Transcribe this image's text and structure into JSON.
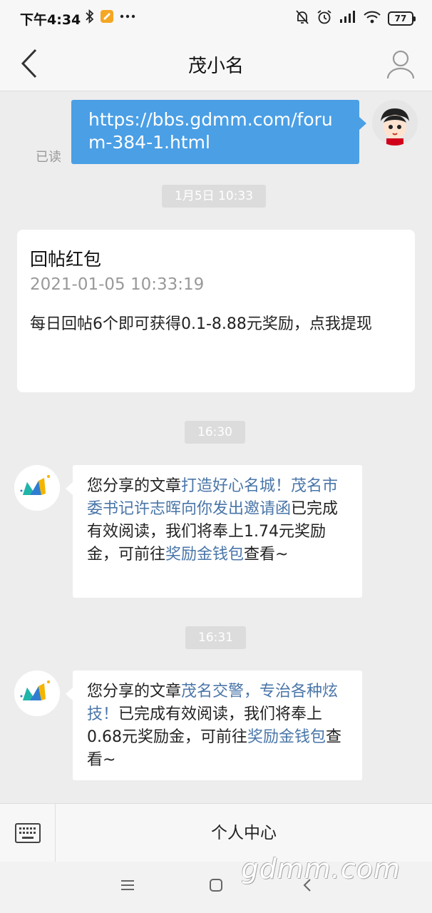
{
  "status_bar": {
    "time": "下午4:34",
    "battery": "77",
    "icons_left": [
      "bluetooth-icon",
      "notes-icon",
      "more-icon"
    ],
    "icons_right": [
      "mute-icon",
      "alarm-icon",
      "signal-icon",
      "wifi-icon",
      "battery-icon"
    ]
  },
  "nav": {
    "title": "茂小名",
    "back_icon": "chevron-left-icon",
    "profile_icon": "person-icon"
  },
  "messages": {
    "outgoing": {
      "text": "https://bbs.gdmm.com/forum-384-1.html",
      "status": "已读"
    },
    "time_1": "1月5日 10:33",
    "card": {
      "title": "回帖红包",
      "date": "2021-01-05 10:33:19",
      "body": "每日回帖6个即可获得0.1-8.88元奖励，点我提现"
    },
    "time_2": "16:30",
    "msg_1": {
      "prefix": "您分享的文章",
      "link": "打造好心名城！茂名市委书记许志晖向你发出邀请函",
      "middle": "已完成有效阅读，我们将奉上1.74元奖励金，可前往",
      "wallet": "奖励金钱包",
      "suffix": "查看~"
    },
    "time_3": "16:31",
    "msg_2": {
      "prefix": "您分享的文章",
      "link": "茂名交警，专治各种炫技！",
      "middle": "已完成有效阅读，我们将奉上0.68元奖励金，可前往",
      "wallet": "奖励金钱包",
      "suffix": "查看~"
    }
  },
  "bottom_bar": {
    "keyboard_icon": "keyboard-icon",
    "menu_label": "个人中心"
  },
  "system_nav": {
    "icons": [
      "menu-icon",
      "home-icon",
      "back-icon"
    ],
    "watermark": "gdmm.com"
  },
  "colors": {
    "bubble_out": "#4a9fe5",
    "link": "#4a76a8",
    "background": "#ededed"
  }
}
